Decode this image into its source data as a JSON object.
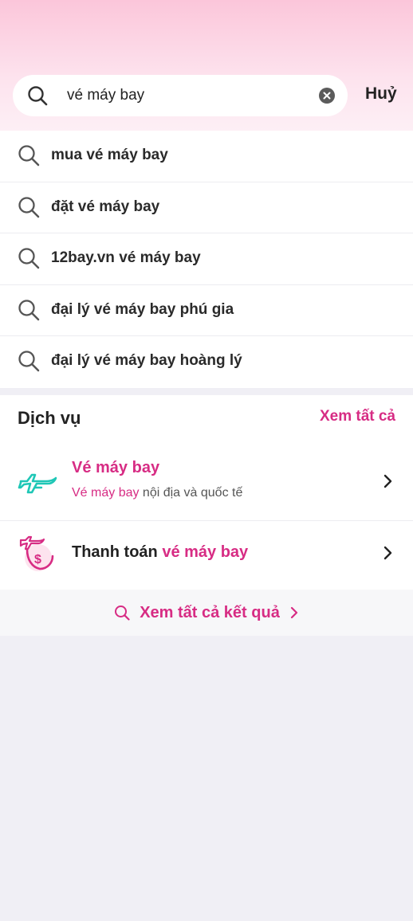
{
  "search": {
    "query": "vé máy bay",
    "cancel_label": "Huỷ"
  },
  "suggestions": [
    {
      "label": "mua vé máy bay"
    },
    {
      "label": "đặt vé máy bay"
    },
    {
      "label": "12bay.vn vé máy bay"
    },
    {
      "label": "đại lý vé máy bay phú gia"
    },
    {
      "label": "đại lý vé máy bay hoàng lý"
    }
  ],
  "services": {
    "title": "Dịch vụ",
    "see_all": "Xem tất cả",
    "items": [
      {
        "name": "Vé máy bay",
        "desc_highlight": "Vé máy bay",
        "desc_rest": " nội địa và quốc tế",
        "icon": "airplane-icon"
      },
      {
        "name_prefix": "Thanh toán ",
        "name_highlight": "vé máy bay",
        "icon": "flight-payment-icon"
      }
    ]
  },
  "all_results_label": "Xem tất cả kết quả",
  "colors": {
    "accent": "#d72c84",
    "teal": "#1fc7b6",
    "header_pink": "#fbc6da"
  }
}
